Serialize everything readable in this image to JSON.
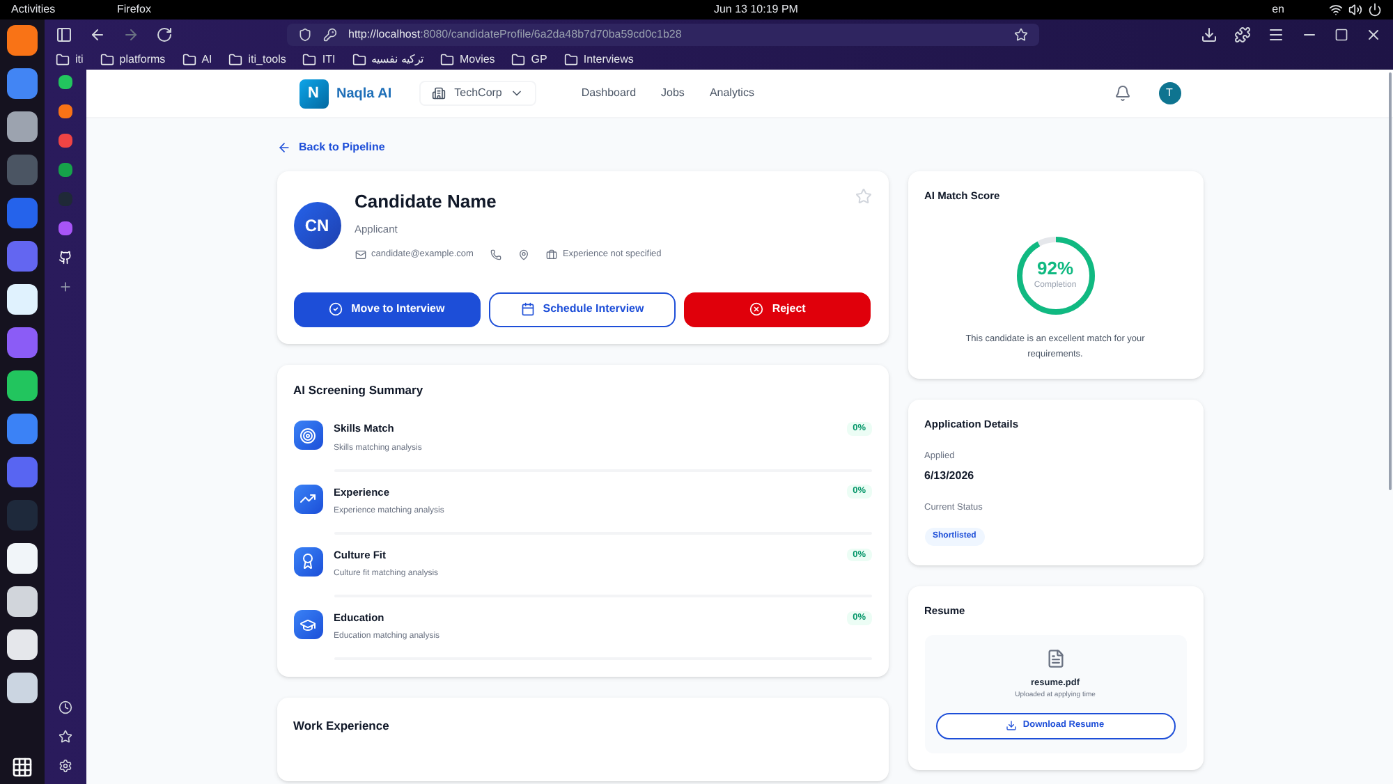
{
  "topbar": {
    "activities": "Activities",
    "app": "Firefox",
    "clock": "Jun 13  10:19 PM",
    "language": "en"
  },
  "browser": {
    "url_host": "http://localhost",
    "url_rest": ":8080/candidateProfile/6a2da48b7d70ba59cd0c1b28",
    "bookmarks": [
      "iti",
      "platforms",
      "AI",
      "iti_tools",
      "ITI",
      "تركيه نفسيه",
      "Movies",
      "GP",
      "Interviews"
    ]
  },
  "header": {
    "logo_letter": "N",
    "brand": "Naqla AI",
    "company": "TechCorp",
    "nav": [
      {
        "label": "Dashboard",
        "selected": false
      },
      {
        "label": "Jobs",
        "selected": false
      },
      {
        "label": "Analytics",
        "selected": false
      }
    ],
    "user_initial": "T"
  },
  "back_link": "Back to Pipeline",
  "candidate": {
    "initials": "CN",
    "name": "Candidate Name",
    "role": "Applicant",
    "email": "candidate@example.com",
    "experience": "Experience not specified",
    "actions": [
      {
        "label": "Move to Interview",
        "kind": "primary"
      },
      {
        "label": "Schedule Interview",
        "kind": "outline"
      },
      {
        "label": "Reject",
        "kind": "danger"
      }
    ]
  },
  "screening": {
    "title": "AI Screening Summary",
    "items": [
      {
        "kind": "target",
        "title": "Skills Match",
        "subtitle": "Skills matching analysis",
        "score": "0%"
      },
      {
        "kind": "trend",
        "title": "Experience",
        "subtitle": "Experience matching analysis",
        "score": "0%"
      },
      {
        "kind": "award",
        "title": "Culture Fit",
        "subtitle": "Culture fit matching analysis",
        "score": "0%"
      },
      {
        "kind": "education",
        "title": "Education",
        "subtitle": "Education matching analysis",
        "score": "0%"
      }
    ]
  },
  "work_experience": {
    "title": "Work Experience"
  },
  "match": {
    "title": "AI Match Score",
    "value": "92%",
    "caption": "Completion",
    "level": 0.92,
    "note": "This candidate is an excellent match for your requirements."
  },
  "application": {
    "title": "Application Details",
    "applied_label": "Applied",
    "applied": "6/13/2026",
    "status_label": "Current Status",
    "status": "Shortlisted"
  },
  "resume": {
    "title": "Resume",
    "file": "resume.pdf",
    "note": "Uploaded at applying time",
    "button": "Download Resume"
  }
}
